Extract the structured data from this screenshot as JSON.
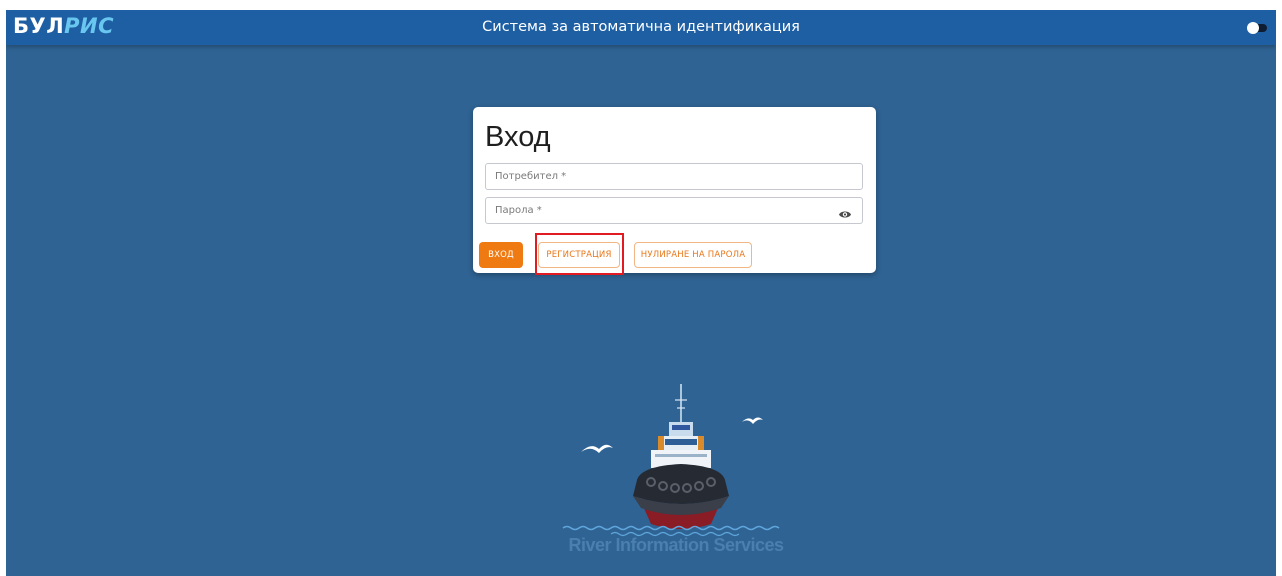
{
  "header": {
    "logo_part_a": "БУЛ",
    "logo_part_b": "РИС",
    "title": "Система за автоматична идентификация",
    "theme_toggle_state": "on"
  },
  "login": {
    "title": "Вход",
    "username_placeholder": "Потребител *",
    "password_placeholder": "Парола *",
    "login_button": "ВХОД",
    "register_button": "РЕГИСТРАЦИЯ",
    "reset_button": "НУЛИРАНЕ НА ПАРОЛА"
  },
  "footer": {
    "brand": "River Information Services"
  },
  "colors": {
    "background": "#2f6393",
    "topbar": "#1e5fa4",
    "accent": "#ef7a12",
    "highlight": "#e21b23"
  },
  "icons": [
    "eye-icon",
    "toggle-icon"
  ]
}
